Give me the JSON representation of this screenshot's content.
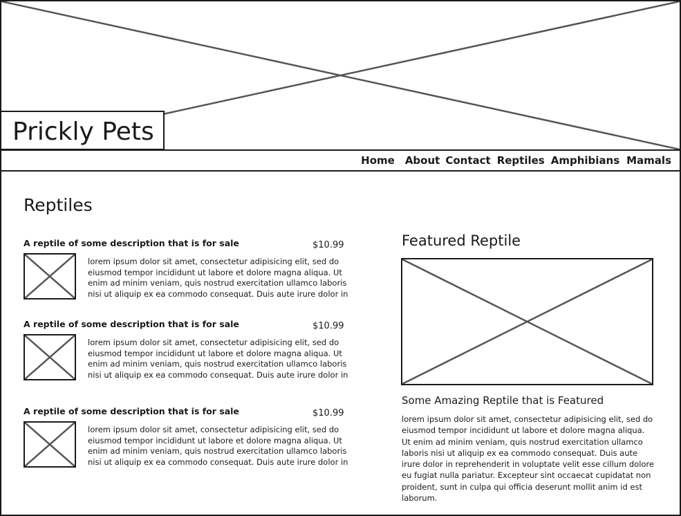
{
  "header": {
    "site_title": "Prickly Pets"
  },
  "nav": {
    "items": [
      {
        "label": "Home"
      },
      {
        "label": "About"
      },
      {
        "label": "Contact"
      },
      {
        "label": "Reptiles"
      },
      {
        "label": "Amphibians"
      },
      {
        "label": "Mamals"
      }
    ]
  },
  "main": {
    "section_title": "Reptiles",
    "items": [
      {
        "title": "A reptile of some description that is for sale",
        "price": "$10.99",
        "description": "lorem ipsum dolor sit amet, consectetur adipisicing elit, sed do eiusmod tempor incididunt ut labore et dolore magna aliqua. Ut enim ad minim veniam, quis nostrud exercitation ullamco laboris nisi ut aliquip ex ea commodo consequat. Duis aute irure dolor in"
      },
      {
        "title": "A reptile of some description that is for sale",
        "price": "$10.99",
        "description": "lorem ipsum dolor sit amet, consectetur adipisicing elit, sed do eiusmod tempor incididunt ut labore et dolore magna aliqua. Ut enim ad minim veniam, quis nostrud exercitation ullamco laboris nisi ut aliquip ex ea commodo consequat. Duis aute irure dolor in"
      },
      {
        "title": "A reptile of some description that is for sale",
        "price": "$10.99",
        "description": "lorem ipsum dolor sit amet, consectetur adipisicing elit, sed do eiusmod tempor incididunt ut labore et dolore magna aliqua. Ut enim ad minim veniam, quis nostrud exercitation ullamco laboris nisi ut aliquip ex ea commodo consequat. Duis aute irure dolor in"
      }
    ]
  },
  "featured": {
    "heading": "Featured Reptile",
    "name": "Some Amazing Reptile that is Featured",
    "description": "lorem ipsum dolor sit amet, consectetur adipisicing elit, sed do eiusmod tempor incididunt ut labore et dolore magna aliqua. Ut enim ad minim veniam, quis nostrud exercitation ullamco laboris nisi ut aliquip ex ea commodo consequat. Duis aute irure dolor in reprehenderit in voluptate velit esse cillum dolore eu fugiat nulla pariatur. Excepteur sint occaecat cupidatat non proident, sunt in culpa qui officia deserunt mollit anim id est laborum."
  }
}
